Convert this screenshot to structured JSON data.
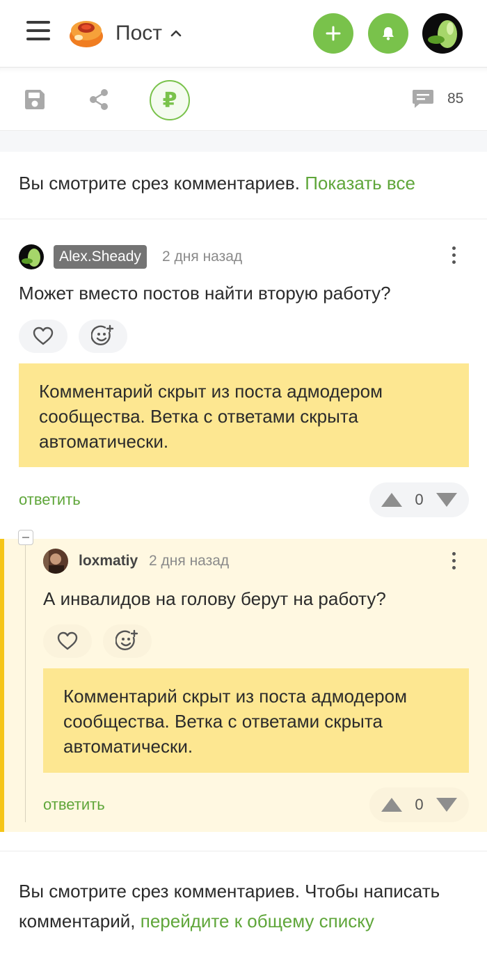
{
  "header": {
    "title": "Пост",
    "icons": {
      "menu": "menu-icon",
      "logo": "pikabu-logo",
      "chevron": "chevron-up-icon",
      "add": "plus-icon",
      "notifications": "bell-icon",
      "avatar": "user-avatar"
    },
    "accent_color": "#79c24b"
  },
  "actionbar": {
    "icons": [
      "save-icon",
      "share-icon",
      "ruble-icon",
      "comments-icon"
    ],
    "donate_symbol": "₽",
    "comments_count": "85"
  },
  "slice_notice": {
    "text": "Вы смотрите срез комментариев. ",
    "link": "Показать все"
  },
  "comments": [
    {
      "author": "Alex.Sheady",
      "time": "2 дня назад",
      "text": "Может вместо постов найти вторую работу?",
      "hidden_note": "Комментарий скрыт из поста адмодером сообщества. Ветка с ответами скрыта автоматически.",
      "reply_label": "ответить",
      "rating": "0"
    },
    {
      "author": "loxmatiy",
      "time": "2 дня назад",
      "text": "А инвалидов на голову берут на работу?",
      "hidden_note": "Комментарий скрыт из поста адмодером сообщества. Ветка с ответами скрыта автоматически.",
      "reply_label": "ответить",
      "rating": "0"
    }
  ],
  "bottom_notice": {
    "text": "Вы смотрите срез комментариев. Чтобы написать комментарий, ",
    "link": "перейдите к общему списку"
  },
  "colors": {
    "link_green": "#5fa63a",
    "hidden_box": "#fde791",
    "thread_bg": "#fff8e1",
    "thread_bar": "#f5c518"
  }
}
